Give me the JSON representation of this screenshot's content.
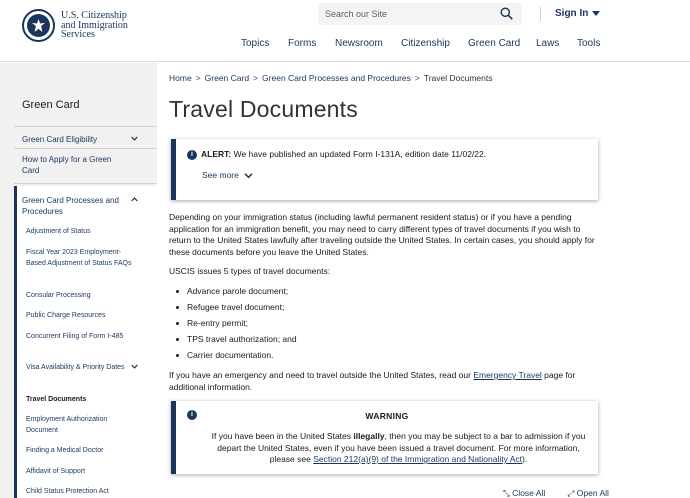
{
  "header": {
    "logo_lines": [
      "U.S. Citizenship",
      "and Immigration",
      "Services"
    ],
    "search_placeholder": "Search our Site",
    "signin_label": "Sign In",
    "nav": [
      "Topics",
      "Forms",
      "Newsroom",
      "Citizenship",
      "Green Card",
      "Laws",
      "Tools"
    ]
  },
  "sidebar": {
    "title": "Green Card",
    "items": [
      {
        "label": "Green Card Eligibility"
      },
      {
        "label": "How to Apply for a Green Card"
      },
      {
        "label": "Green Card Processes and Procedures"
      }
    ],
    "subitems": [
      "Adjustment of Status",
      "Fiscal Year 2023 Employment-Based Adjustment of Status FAQs",
      "Consular Processing",
      "Public Charge Resources",
      "Concurrent Filing of Form I-485",
      "Visa Availability & Priority Dates",
      "Travel Documents",
      "Employment Authorization Document",
      "Finding a Medical Doctor",
      "Affidavit of Support",
      "Child Status Protection Act"
    ]
  },
  "breadcrumb": [
    "Home",
    "Green Card",
    "Green Card Processes and Procedures",
    "Travel Documents"
  ],
  "page_title": "Travel Documents",
  "alert": {
    "label": "ALERT:",
    "text": " We have published an updated Form I-131A, edition date 11/02/22.",
    "see_more": "See more"
  },
  "intro_paragraph": "Depending on your immigration status (including lawful permanent resident status) or if you have a pending application for an immigration benefit, you may need to carry different types of travel documents if you wish to return to the United States lawfully after traveling outside the United States. In certain cases, you should apply for these documents before you leave the United States.",
  "types_intro": "USCIS issues 5 types of travel documents:",
  "travel_document_types": [
    "Advance parole document;",
    "Refugee travel document;",
    "Re-entry permit;",
    "TPS travel authorization; and",
    "Carrier documentation."
  ],
  "emergency": {
    "before": "If you have an emergency and need to travel outside the United States, read our ",
    "link": "Emergency Travel",
    "after": " page for additional information."
  },
  "warning": {
    "title": "WARNING",
    "part1": "If you have been in the United States ",
    "bold": "illegally",
    "part2": ", then you may be subject to a bar to admission if you depart the United States, even if you have been issued a travel document. For more information, please see ",
    "link": "Section 212(a)(9) of the Immigration and Nationality Act",
    "part3": ")."
  },
  "bottom_links": [
    "Close All",
    "Open All"
  ]
}
